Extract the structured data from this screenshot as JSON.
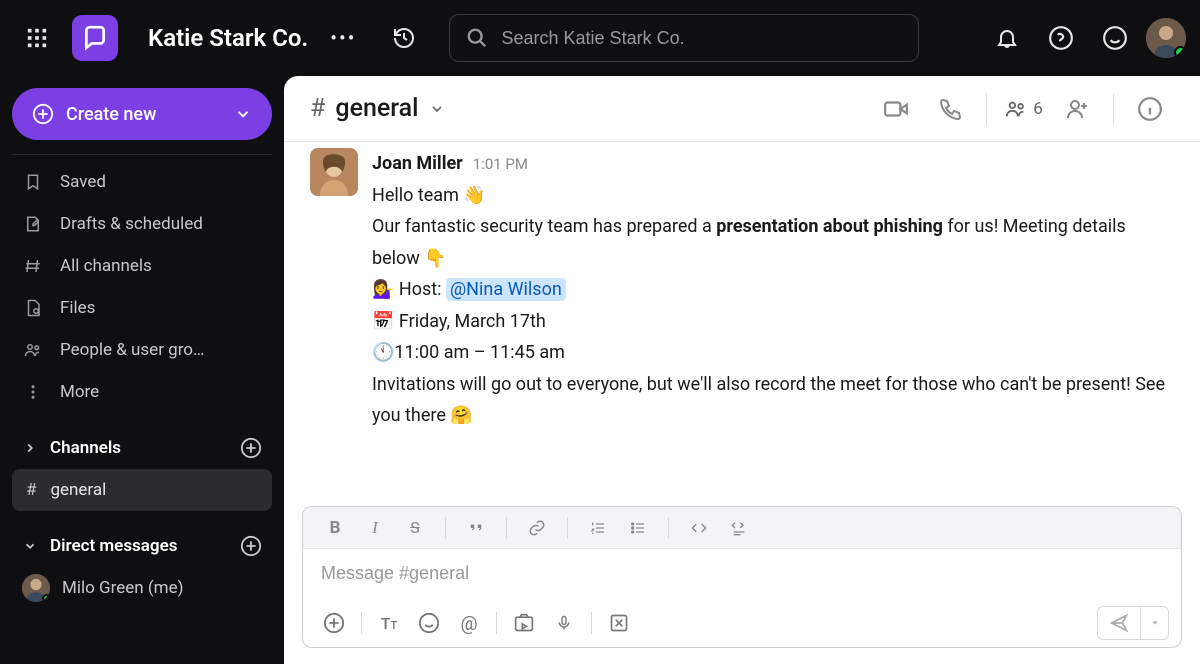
{
  "workspace": {
    "name": "Katie Stark Co."
  },
  "search": {
    "placeholder": "Search Katie Stark Co."
  },
  "sidebar": {
    "create_label": "Create new",
    "nav": {
      "saved": "Saved",
      "drafts": "Drafts & scheduled",
      "all_channels": "All channels",
      "files": "Files",
      "people": "People & user gro…",
      "more": "More"
    },
    "sections": {
      "channels_label": "Channels",
      "dm_label": "Direct messages"
    },
    "channels": [
      {
        "name": "general",
        "active": true
      }
    ],
    "dms": [
      {
        "name": "Milo Green (me)"
      }
    ]
  },
  "channel": {
    "name": "general",
    "member_count": "6"
  },
  "message": {
    "author": "Joan Miller",
    "time": "1:01 PM",
    "line1_a": "Hello team ",
    "emoji_wave": "👋",
    "line2_a": "Our fantastic security team has prepared a ",
    "line2_bold": "presentation about phishing",
    "line2_b": " for us! Meeting details below  ",
    "emoji_pointdown": "👇",
    "emoji_host": "💁‍♀️",
    "host_label": " Host: ",
    "mention": "@Nina Wilson",
    "emoji_calendar": "📅",
    "date_text": " Friday, March 17th",
    "date_badge": "17",
    "emoji_clock": "🕚",
    "time_text": "11:00 am – 11:45 am",
    "line6": "Invitations will go out to everyone, but we'll also record the meet for those who can't be present! See you there ",
    "emoji_hug": "🤗"
  },
  "composer": {
    "placeholder": "Message #general"
  }
}
